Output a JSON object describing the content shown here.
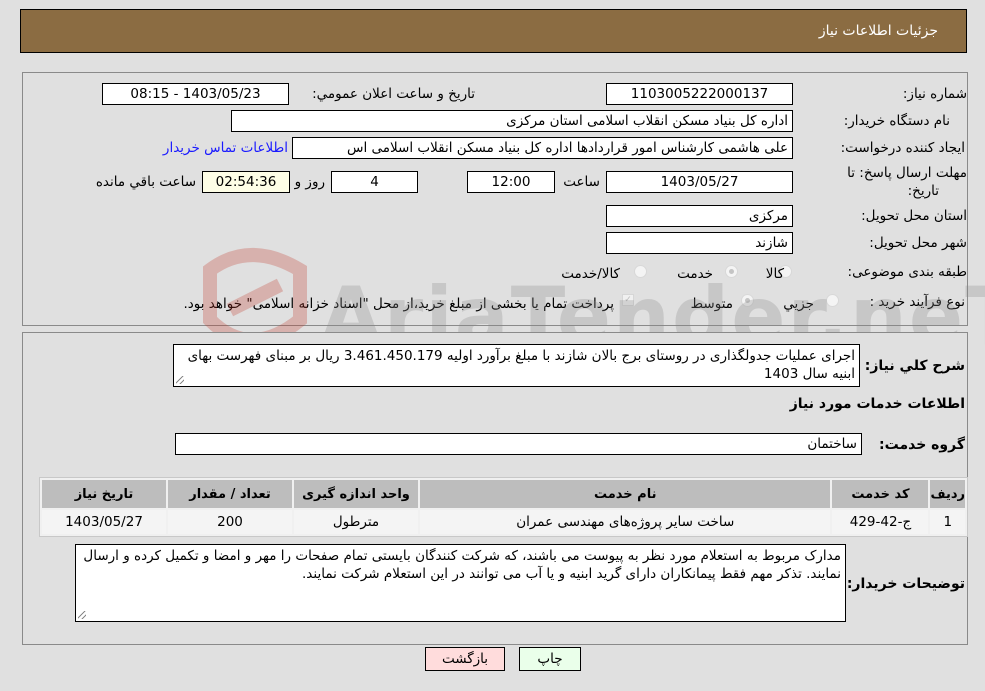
{
  "header": {
    "title": "جزئیات اطلاعات نیاز"
  },
  "form": {
    "need_number": {
      "label": "شماره نیاز:",
      "value": "1103005222000137"
    },
    "announce_datetime": {
      "label": "تاریخ و ساعت اعلان عمومي:",
      "value": "1403/05/23 - 08:15"
    },
    "buyer_org": {
      "label": "نام دستگاه خریدار:",
      "value": "اداره کل بنیاد مسکن انقلاب اسلامی استان مرکزی"
    },
    "requester": {
      "label": "ایجاد کننده درخواست:",
      "value": "علی هاشمی کارشناس امور قراردادها اداره کل بنیاد مسکن انقلاب اسلامی اس",
      "contact_link": "اطلاعات تماس خریدار"
    },
    "deadline": {
      "label_line1": "مهلت ارسال پاسخ: تا",
      "label_line2": "تاریخ:",
      "date": "1403/05/27",
      "time_label": "ساعت",
      "time": "12:00",
      "days": "4",
      "days_label": "روز و",
      "remaining": "02:54:36",
      "remaining_label": "ساعت باقي مانده"
    },
    "province": {
      "label": "استان محل تحویل:",
      "value": "مرکزی"
    },
    "city": {
      "label": "شهر محل تحویل:",
      "value": "شازند"
    },
    "category": {
      "label": "طبقه بندی موضوعی:",
      "options": [
        {
          "label": "کالا",
          "checked": false
        },
        {
          "label": "خدمت",
          "checked": true
        },
        {
          "label": "کالا/خدمت",
          "checked": false
        }
      ]
    },
    "process": {
      "label": "نوع فرآیند خرید :",
      "options": [
        {
          "label": "جزيي",
          "checked": false
        },
        {
          "label": "متوسط",
          "checked": true
        }
      ],
      "payment_note": "پرداخت تمام یا بخشی از مبلغ خرید،از محل \"اسناد خزانه اسلامی\" خواهد بود.",
      "payment_checked": true
    }
  },
  "details": {
    "description_label": "شرح كلي نياز:",
    "description": "اجرای عملیات جدولگذاری در روستای برج بالان شازند با مبلغ برآورد اولیه  3.461.450.179 ریال بر مبنای فهرست بهای ابنیه سال 1403",
    "services_title": "اطلاعات خدمات مورد نياز",
    "service_group_label": "گروه خدمت:",
    "service_group": "ساختمان",
    "table": {
      "headers": [
        "ردیف",
        "کد خدمت",
        "نام خدمت",
        "واحد اندازه گیری",
        "تعداد / مقدار",
        "تاریخ نیاز"
      ],
      "rows": [
        [
          "1",
          "ج-42-429",
          "ساخت سایر پروژه‌های مهندسی عمران",
          "مترطول",
          "200",
          "1403/05/27"
        ]
      ]
    },
    "buyer_notes_label": "توضيحات خريدار:",
    "buyer_notes": "مدارک مربوط به استعلام مورد نظر به پیوست می باشند، که شرکت کنندگان بایستی تمام صفحات را مهر و امضا و تکمیل کرده و ارسال نمایند. تذکر مهم فقط پیمانکاران دارای گرید ابنیه و یا آب می توانند در این استعلام شرکت نمایند."
  },
  "buttons": {
    "print": "چاپ",
    "back": "بازگشت"
  },
  "watermark": {
    "text": "AriaTender.neT"
  }
}
